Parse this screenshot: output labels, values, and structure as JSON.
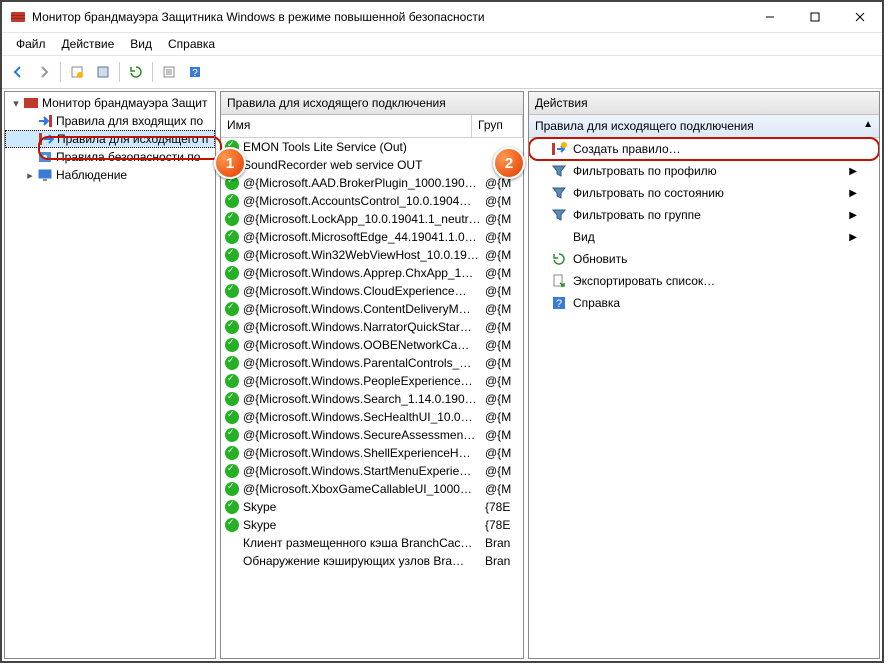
{
  "title": "Монитор брандмауэра Защитника Windows в режиме повышенной безопасности",
  "menus": {
    "file": "Файл",
    "action": "Действие",
    "view": "Вид",
    "help": "Справка"
  },
  "tree": {
    "root": "Монитор брандмауэра Защит",
    "in": "Правила для входящих по",
    "out": "Правила для исходящего п",
    "sec": "Правила безопасности по",
    "watch": "Наблюдение"
  },
  "center": {
    "header": "Правила для исходящего подключения",
    "col_name": "Имя",
    "col_group": "Груп",
    "rules": [
      {
        "n": "EMON Tools Lite Service (Out)",
        "g": "",
        "on": true
      },
      {
        "n": "SoundRecorder web service OUT",
        "g": "",
        "on": true
      },
      {
        "n": "@{Microsoft.AAD.BrokerPlugin_1000.190…",
        "g": "@{M",
        "on": true
      },
      {
        "n": "@{Microsoft.AccountsControl_10.0.1904…",
        "g": "@{M",
        "on": true
      },
      {
        "n": "@{Microsoft.LockApp_10.0.19041.1_neutr…",
        "g": "@{M",
        "on": true
      },
      {
        "n": "@{Microsoft.MicrosoftEdge_44.19041.1.0…",
        "g": "@{M",
        "on": true
      },
      {
        "n": "@{Microsoft.Win32WebViewHost_10.0.19…",
        "g": "@{M",
        "on": true
      },
      {
        "n": "@{Microsoft.Windows.Apprep.ChxApp_1…",
        "g": "@{M",
        "on": true
      },
      {
        "n": "@{Microsoft.Windows.CloudExperience…",
        "g": "@{M",
        "on": true
      },
      {
        "n": "@{Microsoft.Windows.ContentDeliveryM…",
        "g": "@{M",
        "on": true
      },
      {
        "n": "@{Microsoft.Windows.NarratorQuickStar…",
        "g": "@{M",
        "on": true
      },
      {
        "n": "@{Microsoft.Windows.OOBENetworkCa…",
        "g": "@{M",
        "on": true
      },
      {
        "n": "@{Microsoft.Windows.ParentalControls_…",
        "g": "@{M",
        "on": true
      },
      {
        "n": "@{Microsoft.Windows.PeopleExperience…",
        "g": "@{M",
        "on": true
      },
      {
        "n": "@{Microsoft.Windows.Search_1.14.0.190…",
        "g": "@{M",
        "on": true
      },
      {
        "n": "@{Microsoft.Windows.SecHealthUI_10.0…",
        "g": "@{M",
        "on": true
      },
      {
        "n": "@{Microsoft.Windows.SecureAssessmen…",
        "g": "@{M",
        "on": true
      },
      {
        "n": "@{Microsoft.Windows.ShellExperienceH…",
        "g": "@{M",
        "on": true
      },
      {
        "n": "@{Microsoft.Windows.StartMenuExperie…",
        "g": "@{M",
        "on": true
      },
      {
        "n": "@{Microsoft.XboxGameCallableUI_1000…",
        "g": "@{M",
        "on": true
      },
      {
        "n": "Skype",
        "g": "{78E",
        "on": true
      },
      {
        "n": "Skype",
        "g": "{78E",
        "on": true
      },
      {
        "n": "Клиент размещенного кэша BranchCac…",
        "g": "Bran",
        "on": false
      },
      {
        "n": "Обнаружение кэширующих узлов Bra…",
        "g": "Bran",
        "on": false
      }
    ]
  },
  "actions": {
    "header": "Действия",
    "section": "Правила для исходящего подключения",
    "create": "Создать правило…",
    "filter_profile": "Фильтровать по профилю",
    "filter_state": "Фильтровать по состоянию",
    "filter_group": "Фильтровать по группе",
    "view": "Вид",
    "refresh": "Обновить",
    "export": "Экспортировать список…",
    "help": "Справка"
  }
}
